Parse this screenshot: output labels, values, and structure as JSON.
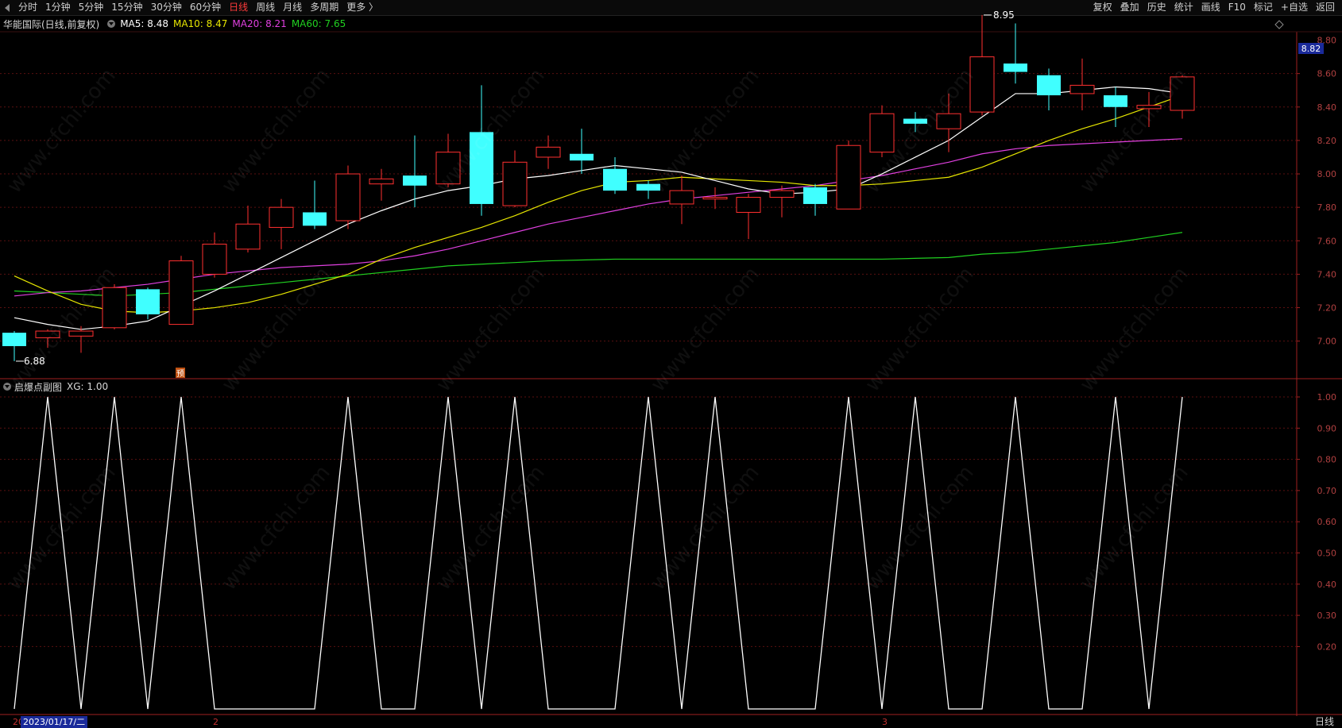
{
  "toolbar": {
    "left_items": [
      "分时",
      "1分钟",
      "5分钟",
      "15分钟",
      "30分钟",
      "60分钟",
      "日线",
      "周线",
      "月线",
      "多周期",
      "更多 〉"
    ],
    "active_index": 6,
    "right_items": [
      "复权",
      "叠加",
      "历史",
      "统计",
      "画线",
      "F10",
      "标记",
      "+自选",
      "返回"
    ]
  },
  "info": {
    "stock": "华能国际(日线,前复权)",
    "ma5": "MA5: 8.48",
    "ma10": "MA10: 8.47",
    "ma20": "MA20: 8.21",
    "ma60": "MA60: 7.65",
    "colors": {
      "ma5": "#ffffff",
      "ma10": "#e6e600",
      "ma20": "#e040e0",
      "ma60": "#20d020"
    }
  },
  "sub": {
    "title": "启爆点副图",
    "value": "XG: 1.00"
  },
  "price_axis": {
    "labels": [
      "8.60",
      "8.40",
      "8.20",
      "8.00",
      "7.80",
      "7.60",
      "7.40",
      "7.20",
      "7.00"
    ],
    "current": "8.82",
    "top_partial": "8.80"
  },
  "sub_axis": {
    "labels": [
      "1.00",
      "0.90",
      "0.80",
      "0.70",
      "0.60",
      "0.50",
      "0.40",
      "0.30",
      "0.20"
    ]
  },
  "annotations": {
    "high": "8.95",
    "low": "6.88",
    "pre_marker": "预"
  },
  "datebar": {
    "left_stub": "20",
    "current_date": "2023/01/17/二",
    "month_ticks": [
      "2",
      "3"
    ],
    "period": "日线"
  },
  "watermark": "www.cfchi.com",
  "chart_data": {
    "type": "candlestick",
    "candles": [
      [
        7.05,
        6.97,
        7.06,
        6.88
      ],
      [
        7.02,
        7.06,
        7.07,
        6.96
      ],
      [
        7.03,
        7.06,
        7.09,
        6.93
      ],
      [
        7.08,
        7.32,
        7.34,
        7.07
      ],
      [
        7.31,
        7.16,
        7.32,
        7.13
      ],
      [
        7.1,
        7.48,
        7.51,
        7.1
      ],
      [
        7.4,
        7.58,
        7.65,
        7.38
      ],
      [
        7.55,
        7.7,
        7.81,
        7.53
      ],
      [
        7.68,
        7.8,
        7.85,
        7.55
      ],
      [
        7.77,
        7.69,
        7.96,
        7.67
      ],
      [
        7.72,
        8.0,
        8.05,
        7.67
      ],
      [
        7.94,
        7.97,
        8.03,
        7.84
      ],
      [
        7.99,
        7.93,
        8.23,
        7.8
      ],
      [
        7.94,
        8.13,
        8.24,
        7.92
      ],
      [
        8.25,
        7.82,
        8.53,
        7.75
      ],
      [
        7.81,
        8.07,
        8.14,
        7.8
      ],
      [
        8.1,
        8.16,
        8.23,
        8.03
      ],
      [
        8.12,
        8.08,
        8.27,
        8.0
      ],
      [
        8.03,
        7.9,
        8.1,
        7.88
      ],
      [
        7.94,
        7.9,
        7.96,
        7.85
      ],
      [
        7.82,
        7.9,
        7.99,
        7.7
      ],
      [
        7.85,
        7.86,
        7.92,
        7.79
      ],
      [
        7.77,
        7.86,
        7.88,
        7.61
      ],
      [
        7.86,
        7.9,
        7.93,
        7.74
      ],
      [
        7.92,
        7.82,
        7.94,
        7.75
      ],
      [
        7.79,
        8.17,
        8.2,
        7.79
      ],
      [
        8.13,
        8.36,
        8.41,
        8.1
      ],
      [
        8.33,
        8.3,
        8.37,
        8.25
      ],
      [
        8.27,
        8.36,
        8.48,
        8.13
      ],
      [
        8.37,
        8.7,
        8.95,
        8.35
      ],
      [
        8.66,
        8.61,
        8.9,
        8.54
      ],
      [
        8.59,
        8.47,
        8.63,
        8.38
      ],
      [
        8.48,
        8.53,
        8.69,
        8.38
      ],
      [
        8.47,
        8.4,
        8.52,
        8.28
      ],
      [
        8.39,
        8.41,
        8.49,
        8.28
      ],
      [
        8.38,
        8.58,
        8.59,
        8.33
      ]
    ],
    "ma5": [
      7.14,
      7.1,
      7.07,
      7.09,
      7.12,
      7.21,
      7.3,
      7.4,
      7.5,
      7.6,
      7.7,
      7.78,
      7.85,
      7.9,
      7.93,
      7.97,
      7.99,
      8.02,
      8.05,
      8.03,
      8.01,
      7.96,
      7.91,
      7.88,
      7.89,
      7.91,
      8.0,
      8.1,
      8.2,
      8.34,
      8.48,
      8.48,
      8.5,
      8.52,
      8.51,
      8.48
    ],
    "ma10": [
      7.39,
      7.3,
      7.22,
      7.18,
      7.17,
      7.18,
      7.2,
      7.23,
      7.28,
      7.34,
      7.4,
      7.49,
      7.56,
      7.62,
      7.68,
      7.75,
      7.83,
      7.9,
      7.95,
      7.96,
      7.98,
      7.97,
      7.96,
      7.95,
      7.93,
      7.93,
      7.94,
      7.96,
      7.98,
      8.04,
      8.12,
      8.2,
      8.27,
      8.33,
      8.4,
      8.47
    ],
    "ma20": [
      7.27,
      7.29,
      7.3,
      7.32,
      7.34,
      7.37,
      7.4,
      7.42,
      7.44,
      7.45,
      7.46,
      7.48,
      7.51,
      7.55,
      7.6,
      7.65,
      7.7,
      7.74,
      7.78,
      7.82,
      7.85,
      7.87,
      7.89,
      7.91,
      7.93,
      7.96,
      7.99,
      8.03,
      8.07,
      8.12,
      8.15,
      8.17,
      8.18,
      8.19,
      8.2,
      8.21
    ],
    "ma60": [
      7.3,
      7.29,
      7.28,
      7.27,
      7.28,
      7.29,
      7.31,
      7.33,
      7.35,
      7.37,
      7.39,
      7.41,
      7.43,
      7.45,
      7.46,
      7.47,
      7.48,
      7.485,
      7.49,
      7.49,
      7.49,
      7.49,
      7.49,
      7.49,
      7.49,
      7.49,
      7.49,
      7.495,
      7.5,
      7.52,
      7.53,
      7.55,
      7.57,
      7.59,
      7.62,
      7.65
    ],
    "xg": [
      0,
      1,
      0,
      1,
      0,
      1,
      0,
      0,
      0,
      0,
      1,
      0,
      0,
      1,
      0,
      1,
      0,
      0,
      0,
      1,
      0,
      1,
      0,
      0,
      0,
      1,
      0,
      1,
      0,
      0,
      1,
      0,
      0,
      1,
      0,
      1
    ],
    "price_range": [
      6.78,
      8.85
    ],
    "sub_range": [
      0.0,
      1.0
    ]
  }
}
